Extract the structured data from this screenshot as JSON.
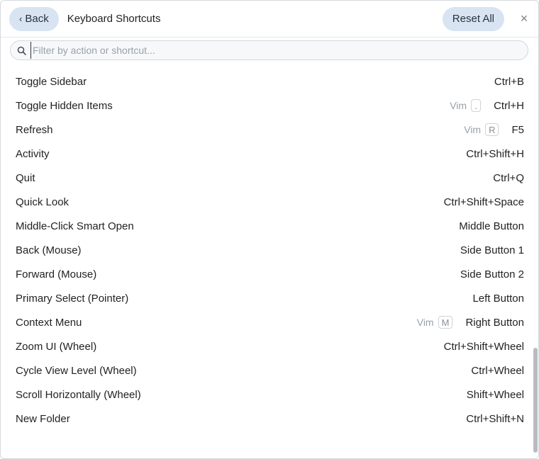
{
  "header": {
    "back_label": "Back",
    "back_chevron": "‹",
    "title": "Keyboard Shortcuts",
    "reset_label": "Reset All",
    "close_glyph": "×"
  },
  "search": {
    "placeholder": "Filter by action or shortcut...",
    "value": ""
  },
  "shortcuts": [
    {
      "action": "Toggle Sidebar",
      "vim_label": "",
      "vim_key": "",
      "shortcut": "Ctrl+B"
    },
    {
      "action": "Toggle Hidden Items",
      "vim_label": "Vim",
      "vim_key": ".",
      "shortcut": "Ctrl+H"
    },
    {
      "action": "Refresh",
      "vim_label": "Vim",
      "vim_key": "R",
      "shortcut": "F5"
    },
    {
      "action": "Activity",
      "vim_label": "",
      "vim_key": "",
      "shortcut": "Ctrl+Shift+H"
    },
    {
      "action": "Quit",
      "vim_label": "",
      "vim_key": "",
      "shortcut": "Ctrl+Q"
    },
    {
      "action": "Quick Look",
      "vim_label": "",
      "vim_key": "",
      "shortcut": "Ctrl+Shift+Space"
    },
    {
      "action": "Middle-Click Smart Open",
      "vim_label": "",
      "vim_key": "",
      "shortcut": "Middle Button"
    },
    {
      "action": "Back (Mouse)",
      "vim_label": "",
      "vim_key": "",
      "shortcut": "Side Button 1"
    },
    {
      "action": "Forward (Mouse)",
      "vim_label": "",
      "vim_key": "",
      "shortcut": "Side Button 2"
    },
    {
      "action": "Primary Select (Pointer)",
      "vim_label": "",
      "vim_key": "",
      "shortcut": "Left Button"
    },
    {
      "action": "Context Menu",
      "vim_label": "Vim",
      "vim_key": "M",
      "shortcut": "Right Button"
    },
    {
      "action": "Zoom UI (Wheel)",
      "vim_label": "",
      "vim_key": "",
      "shortcut": "Ctrl+Shift+Wheel"
    },
    {
      "action": "Cycle View Level (Wheel)",
      "vim_label": "",
      "vim_key": "",
      "shortcut": "Ctrl+Wheel"
    },
    {
      "action": "Scroll Horizontally (Wheel)",
      "vim_label": "",
      "vim_key": "",
      "shortcut": "Shift+Wheel"
    },
    {
      "action": "New Folder",
      "vim_label": "",
      "vim_key": "",
      "shortcut": "Ctrl+Shift+N"
    }
  ],
  "icons": {
    "search": "search-icon",
    "close": "close-icon",
    "back": "chevron-left-icon"
  },
  "colors": {
    "pill_bg": "#d8e4f2",
    "muted": "#9aa0a8",
    "text": "#222222"
  }
}
